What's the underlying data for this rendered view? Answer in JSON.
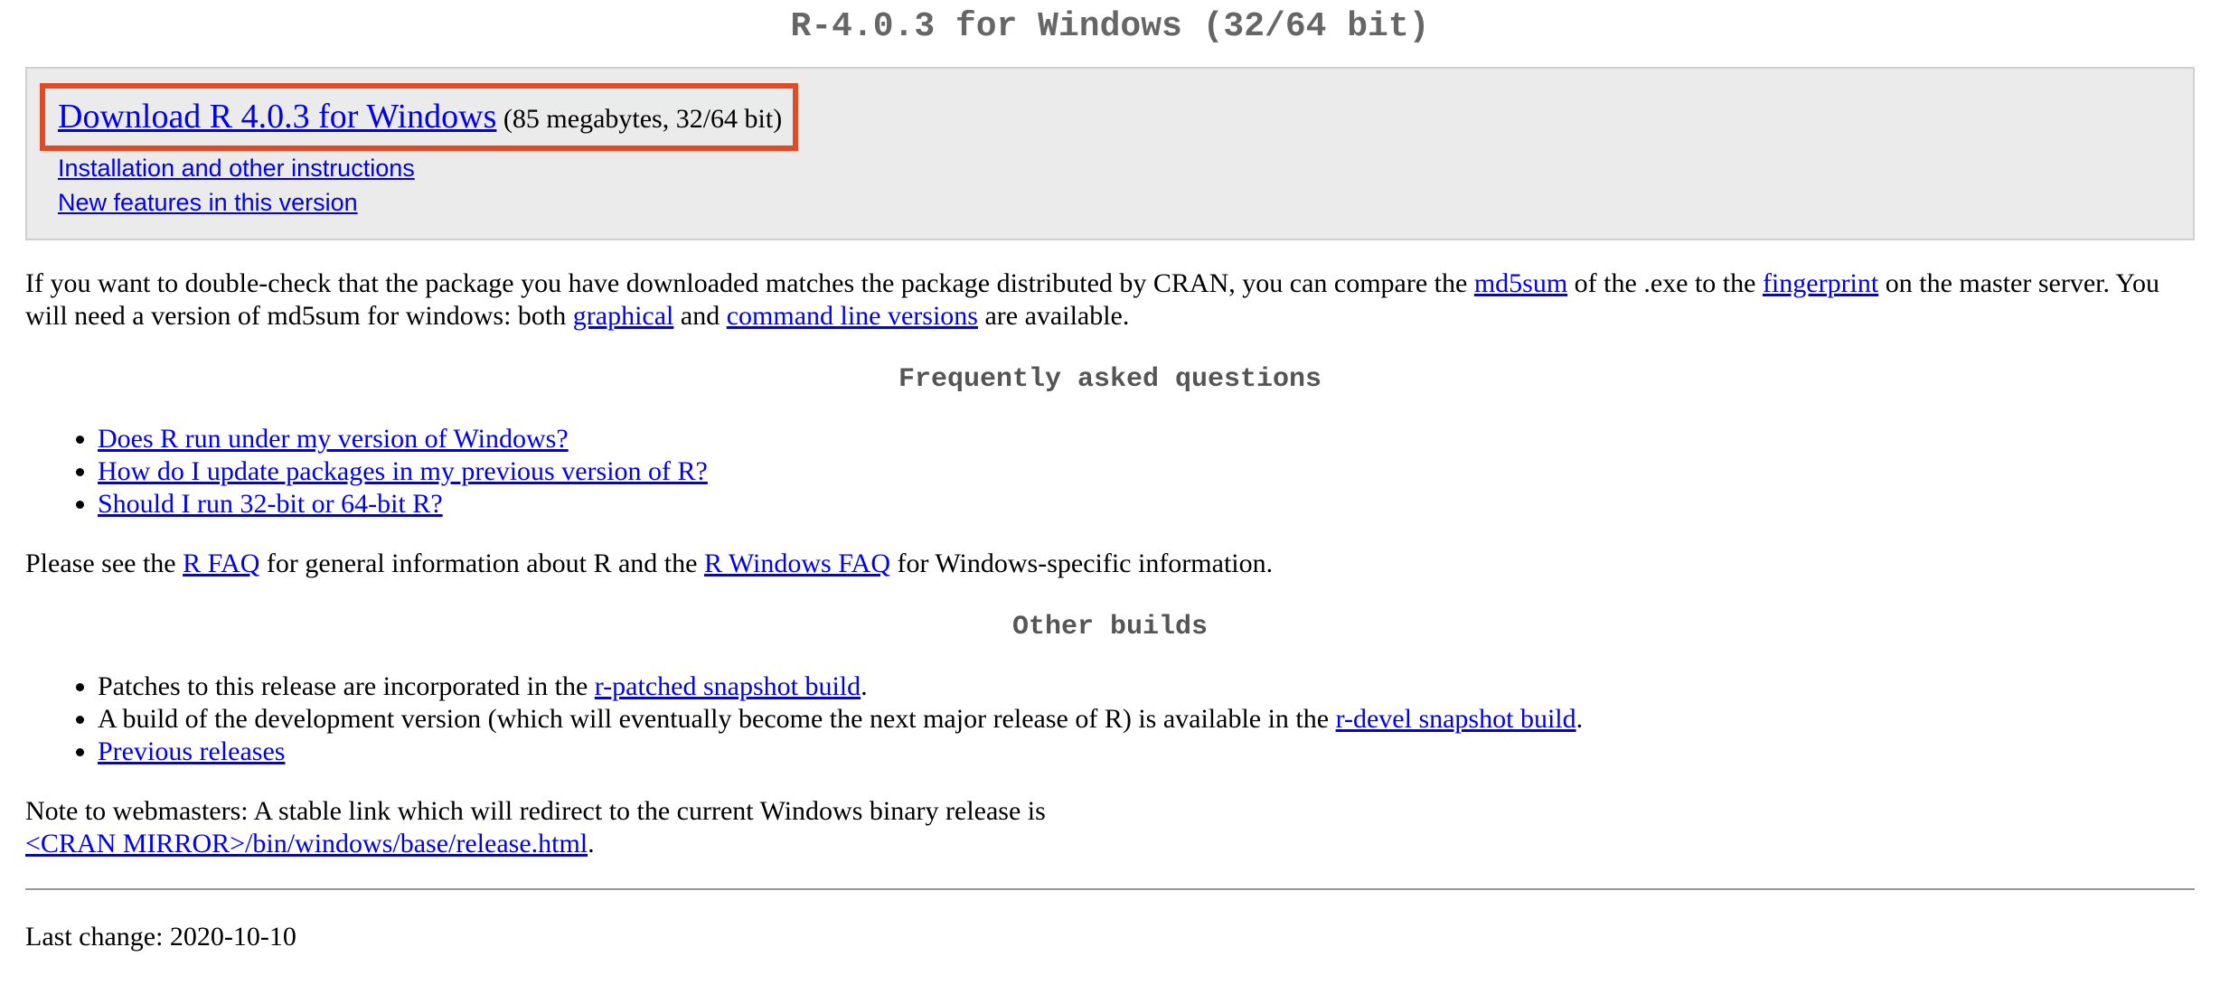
{
  "title": "R-4.0.3 for Windows (32/64 bit)",
  "download": {
    "link": "Download R 4.0.3 for Windows",
    "size": "(85 megabytes, 32/64 bit)",
    "installation": "Installation and other instructions",
    "new_features": "New features in this version"
  },
  "md5": {
    "t1": "If you want to double-check that the package you have downloaded matches the package distributed by CRAN, you can compare the ",
    "md5sum_link": "md5sum",
    "t2": " of the .exe to the ",
    "fingerprint_link": "fingerprint",
    "t3": " on the master server. You will need a version of md5sum for windows: both ",
    "graphical_link": "graphical",
    "t4": " and ",
    "cmdline_link": "command line versions",
    "t5": " are available."
  },
  "faq": {
    "title": "Frequently asked questions",
    "items": [
      "Does R run under my version of Windows?",
      "How do I update packages in my previous version of R?",
      "Should I run 32-bit or 64-bit R?"
    ]
  },
  "faq_para": {
    "t1": "Please see the ",
    "rfaq_link": "R FAQ",
    "t2": " for general information about R and the ",
    "rwinfaq_link": "R Windows FAQ",
    "t3": " for Windows-specific information."
  },
  "other_builds": {
    "title": "Other builds",
    "item1_text": "Patches to this release are incorporated in the ",
    "item1_link": "r-patched snapshot build",
    "item1_end": ".",
    "item2_text": "A build of the development version (which will eventually become the next major release of R) is available in the ",
    "item2_link": "r-devel snapshot build",
    "item2_end": ".",
    "item3_link": "Previous releases"
  },
  "note": {
    "text": "Note to webmasters: A stable link which will redirect to the current Windows binary release is",
    "link": "<CRAN MIRROR>/bin/windows/base/release.html",
    "end": "."
  },
  "last_change": "Last change: 2020-10-10",
  "colors": {
    "link": "#0000ee",
    "highlight_border": "#e24a25",
    "box_bg": "#ebebeb",
    "heading": "#666666"
  }
}
